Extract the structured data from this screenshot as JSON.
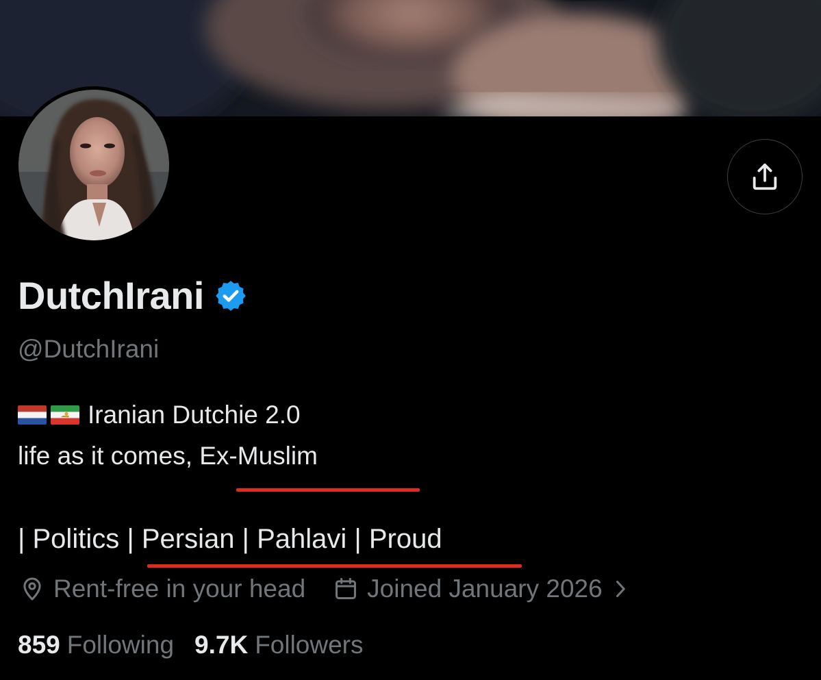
{
  "profile": {
    "display_name": "DutchIrani",
    "handle": "@DutchIrani",
    "verified": true,
    "verified_badge_color": "#1d9bf0"
  },
  "bio": {
    "flags": [
      "flag-netherlands-icon",
      "flag-iran-lion-and-sun-icon"
    ],
    "line1": "Iranian Dutchie 2.0",
    "line2": "life as it comes, Ex-Muslim",
    "line4": "| Politics | Persian | Pahlavi | Proud"
  },
  "meta": {
    "location": "Rent-free in your head",
    "joined": "Joined January 2026"
  },
  "stats": {
    "following_count": "859",
    "following_label": "Following",
    "followers_count": "9.7K",
    "followers_label": "Followers"
  },
  "colors": {
    "background": "#000000",
    "primary_text": "#e7e9ea",
    "secondary_text": "#71767b",
    "annotation_red": "#e02a1c"
  },
  "icons": {
    "share": "share-icon",
    "location": "location-pin-icon",
    "calendar": "calendar-icon",
    "chevron": "chevron-right-icon",
    "verified": "verified-badge-icon"
  }
}
